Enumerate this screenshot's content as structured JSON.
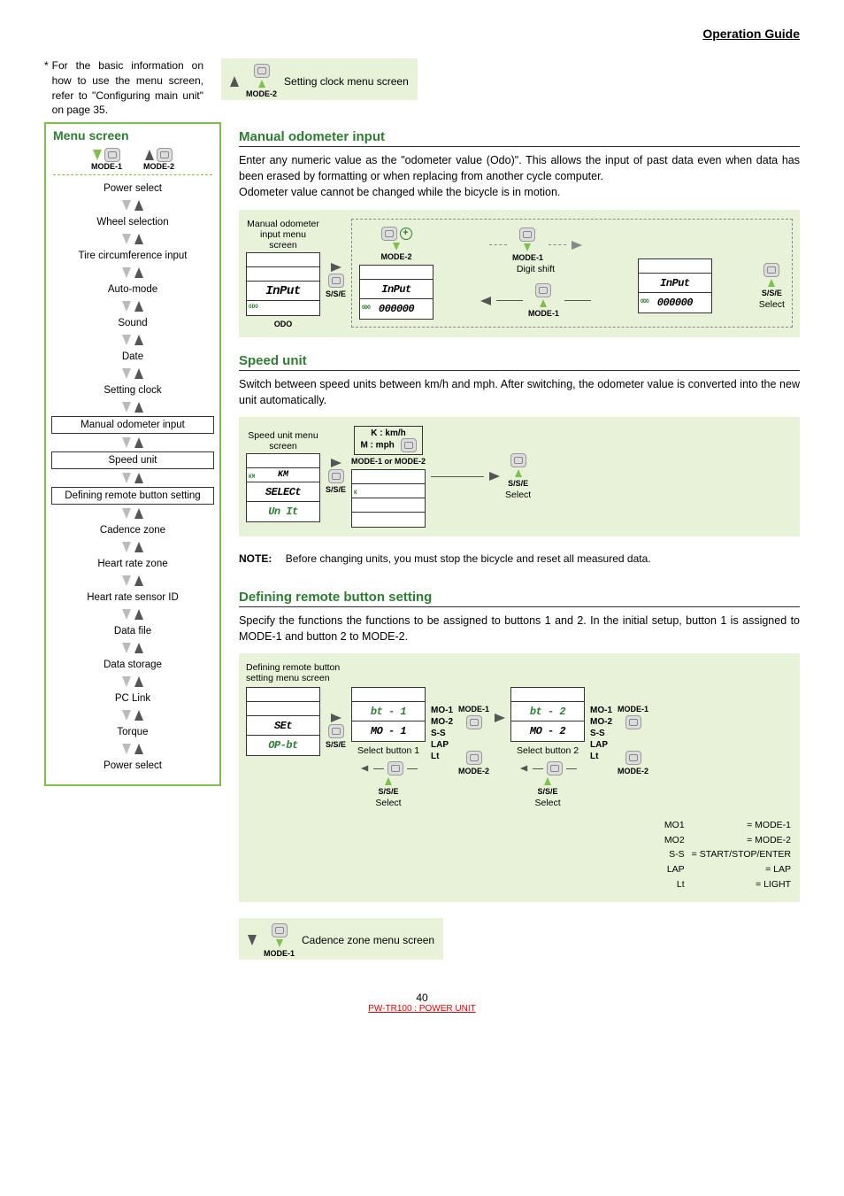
{
  "header": {
    "title": "Operation Guide"
  },
  "basic_note": {
    "asterisk": "*",
    "text": "For the basic information on how to use the menu screen, refer to \"Configuring main unit\" on page 35."
  },
  "top_diagram": {
    "mode_label": "MODE-2",
    "caption": "Setting clock menu screen"
  },
  "sidebar": {
    "title": "Menu screen",
    "mode1": "MODE-1",
    "mode2": "MODE-2",
    "items": [
      {
        "label": "Power select",
        "boxed": false
      },
      {
        "label": "Wheel selection",
        "boxed": false
      },
      {
        "label": "Tire circumference input",
        "boxed": false
      },
      {
        "label": "Auto-mode",
        "boxed": false
      },
      {
        "label": "Sound",
        "boxed": false
      },
      {
        "label": "Date",
        "boxed": false
      },
      {
        "label": "Setting clock",
        "boxed": false
      },
      {
        "label": "Manual odometer input",
        "boxed": true
      },
      {
        "label": "Speed unit",
        "boxed": true
      },
      {
        "label": "Defining remote button setting",
        "boxed": true
      },
      {
        "label": "Cadence zone",
        "boxed": false
      },
      {
        "label": "Heart rate zone",
        "boxed": false
      },
      {
        "label": "Heart rate sensor ID",
        "boxed": false
      },
      {
        "label": "Data file",
        "boxed": false
      },
      {
        "label": "Data storage",
        "boxed": false
      },
      {
        "label": "PC Link",
        "boxed": false
      },
      {
        "label": "Torque",
        "boxed": false
      },
      {
        "label": "Power select",
        "boxed": false
      }
    ]
  },
  "sections": {
    "odo": {
      "title": "Manual odometer input",
      "body": "Enter any numeric value as the \"odometer value (Odo)\". This allows the input of past data even when data has been erased by formatting or when replacing from another cycle computer.\nOdometer value cannot be changed while the bicycle is in motion.",
      "diagram": {
        "menu_label": "Manual odometer input menu screen",
        "lcd1_line": "InPut",
        "odo_label": "ODO",
        "sse": "S/S/E",
        "mode2": "MODE-2",
        "mode1": "MODE-1",
        "digit_shift": "Digit shift",
        "lcd2_line1": "InPut",
        "lcd2_line2": "000000",
        "lcd3_line1": "InPut",
        "lcd3_line2": "000000",
        "select": "Select"
      }
    },
    "speed": {
      "title": "Speed unit",
      "body": "Switch between speed units between km/h and mph. After switching, the odometer value is converted into the new unit automatically.",
      "diagram": {
        "menu_label": "Speed unit menu screen",
        "kmh": "K : km/h",
        "mph": "M : mph",
        "mode12": "MODE-1 or MODE-2",
        "lcd1_km": "KM",
        "lcd1_line1": "SELECt",
        "lcd1_line2": "Un It",
        "sse": "S/S/E",
        "lcd2_k": "K",
        "select": "Select"
      },
      "note_label": "NOTE:",
      "note_text": "Before changing units, you must stop the bicycle and reset all measured data."
    },
    "remote": {
      "title": "Defining remote button setting",
      "body": "Specify the functions the functions to be assigned to buttons 1 and 2. In the initial setup, button 1 is assigned to MODE-1 and button 2 to MODE-2.",
      "diagram": {
        "menu_label": "Defining remote button setting menu screen",
        "lcd1_line1": "SEt",
        "lcd1_line2": "OP-bt",
        "sse": "S/S/E",
        "select_btn1": "Select button 1",
        "select_btn2": "Select button 2",
        "lcd2_top": "bt - 1",
        "lcd2_bot": "MO - 1",
        "lcd3_top": "bt - 2",
        "lcd3_bot": "MO - 2",
        "mode1": "MODE-1",
        "mode2": "MODE-2",
        "select": "Select",
        "options": [
          "MO-1",
          "MO-2",
          "S-S",
          "LAP",
          "Lt"
        ],
        "legend": [
          {
            "k": "MO1",
            "v": "= MODE-1"
          },
          {
            "k": "MO2",
            "v": "= MODE-2"
          },
          {
            "k": "S-S",
            "v": "= START/STOP/ENTER"
          },
          {
            "k": "LAP",
            "v": "= LAP"
          },
          {
            "k": "Lt",
            "v": "= LIGHT"
          }
        ]
      },
      "bottom_caption": "Cadence zone menu screen",
      "bottom_mode": "MODE-1"
    }
  },
  "footer": {
    "page": "40",
    "model": "PW-TR100 : POWER UNIT"
  }
}
